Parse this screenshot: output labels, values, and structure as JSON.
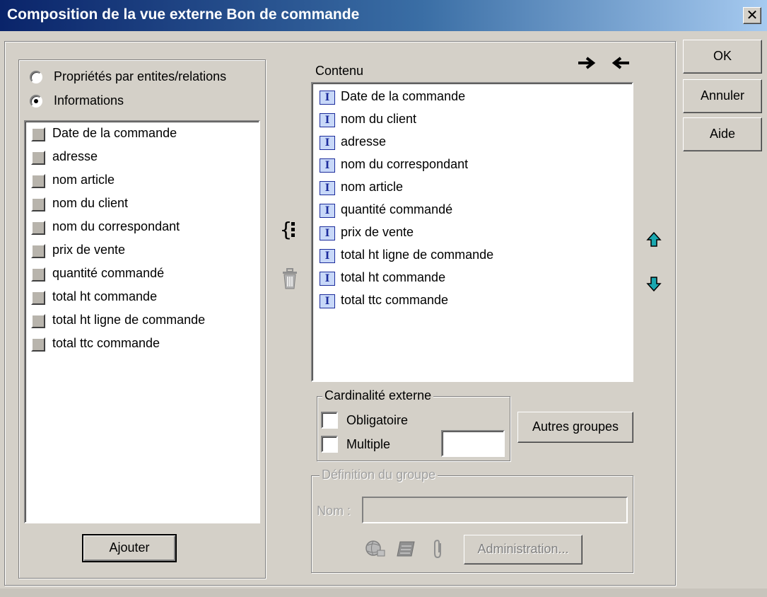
{
  "window": {
    "title": "Composition de la vue externe Bon de commande",
    "close_glyph": "✕"
  },
  "left_panel": {
    "radio_options": [
      {
        "label": "Propriétés par entites/relations",
        "selected": false
      },
      {
        "label": "Informations",
        "selected": true
      }
    ],
    "items": [
      "Date de la commande",
      "adresse",
      "nom article",
      "nom du client",
      "nom du correspondant",
      "prix de vente",
      "quantité commandé",
      "total ht commande",
      "total ht ligne de commande",
      "total ttc commande"
    ],
    "add_button": "Ajouter"
  },
  "middle_tools": {
    "group_icon": "brace-group-icon",
    "delete_icon": "trash-icon"
  },
  "content_panel": {
    "label": "Contenu",
    "items": [
      "Date de la commande",
      "nom du client",
      "adresse",
      "nom du correspondant",
      "nom article",
      "quantité commandé",
      "prix de vente",
      "total ht ligne de commande",
      "total ht commande",
      "total ttc commande"
    ],
    "item_icon_letter": "I"
  },
  "cardinality": {
    "legend": "Cardinalité externe",
    "obligatoire": "Obligatoire",
    "multiple": "Multiple",
    "value": "",
    "other_groups_button": "Autres groupes"
  },
  "group_definition": {
    "legend": "Définition du groupe",
    "name_label": "Nom :",
    "name_value": "",
    "admin_button": "Administration..."
  },
  "buttons": {
    "ok": "OK",
    "cancel": "Annuler",
    "help": "Aide"
  },
  "colors": {
    "title_start": "#0a246a",
    "arrow_teal": "#1aa8b0",
    "face": "#d4d0c8"
  }
}
